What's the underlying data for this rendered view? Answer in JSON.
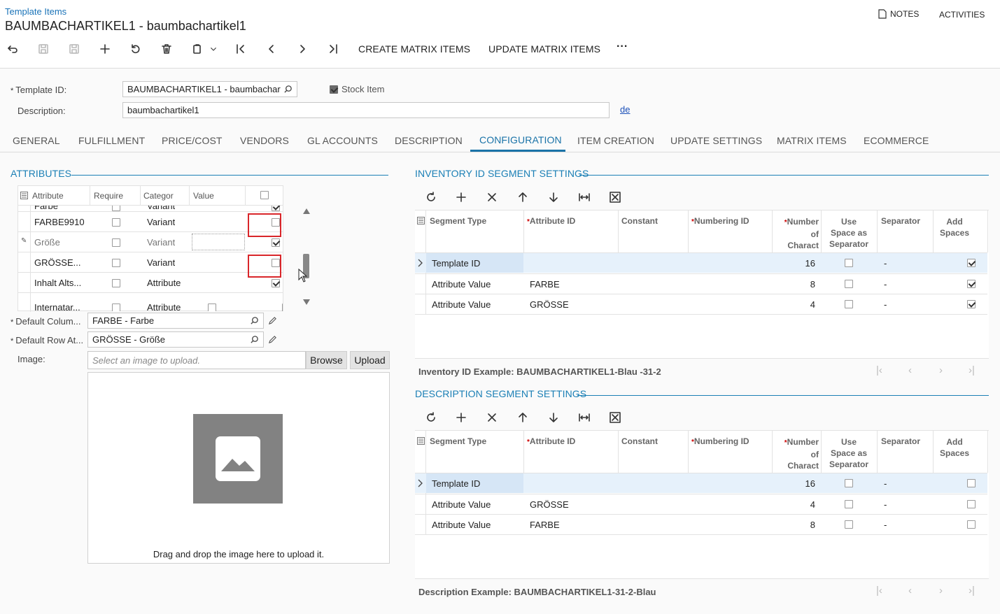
{
  "header": {
    "breadcrumb": "Template Items",
    "title": "BAUMBACHARTIKEL1 - baumbachartikel1",
    "notes": "NOTES",
    "activities": "ACTIVITIES"
  },
  "toolbar": {
    "create_matrix": "CREATE MATRIX ITEMS",
    "update_matrix": "UPDATE MATRIX ITEMS",
    "more": "···"
  },
  "form": {
    "template_id_label": "Template ID:",
    "template_id_value": "BAUMBACHARTIKEL1 - baumbachar",
    "stock_item_label": "Stock Item",
    "description_label": "Description:",
    "description_value": "baumbachartikel1",
    "lang": "de"
  },
  "tabs": [
    "GENERAL",
    "FULFILLMENT",
    "PRICE/COST",
    "VENDORS",
    "GL ACCOUNTS",
    "DESCRIPTION",
    "CONFIGURATION",
    "ITEM CREATION",
    "UPDATE SETTINGS",
    "MATRIX ITEMS",
    "ECOMMERCE"
  ],
  "attributes": {
    "title": "ATTRIBUTES",
    "columns": [
      "Attribute",
      "Require",
      "Categor",
      "Value"
    ],
    "rows": [
      {
        "attribute": "Farbe",
        "category": "Variant",
        "required": false,
        "checked": true
      },
      {
        "attribute": "FARBE9910",
        "category": "Variant",
        "required": false,
        "checked": false
      },
      {
        "attribute": "Größe",
        "category": "Variant",
        "required": false,
        "checked": true
      },
      {
        "attribute": "GRÖSSE...",
        "category": "Variant",
        "required": false,
        "checked": false
      },
      {
        "attribute": "Inhalt Alts...",
        "category": "Attribute",
        "required": false,
        "checked": true
      },
      {
        "attribute": "Internatar...",
        "category": "Attribute",
        "required": false,
        "checked": true
      }
    ],
    "default_column_label": "Default Colum...",
    "default_column_value": "FARBE - Farbe",
    "default_row_label": "Default Row At...",
    "default_row_value": "GRÖSSE - Größe",
    "image_label": "Image:",
    "image_placeholder": "Select an image to upload.",
    "browse": "Browse",
    "upload": "Upload",
    "drop_text": "Drag and drop the image here to upload it."
  },
  "inventory_segments": {
    "title": "INVENTORY ID SEGMENT SETTINGS",
    "columns": {
      "segment_type": "Segment Type",
      "attribute_id": "Attribute ID",
      "constant": "Constant",
      "numbering_id": "Numbering ID",
      "number_a": "Number",
      "number_b": "of",
      "number_c": "Charact",
      "use_a": "Use",
      "use_b": "Space as",
      "use_c": "Separator",
      "separator": "Separator",
      "add_a": "Add",
      "add_b": "Spaces"
    },
    "rows": [
      {
        "segment_type": "Template ID",
        "attribute_id": "",
        "number": "16",
        "use_space": false,
        "separator": "-",
        "add_spaces": true
      },
      {
        "segment_type": "Attribute Value",
        "attribute_id": "FARBE",
        "number": "8",
        "use_space": false,
        "separator": "-",
        "add_spaces": true
      },
      {
        "segment_type": "Attribute Value",
        "attribute_id": "GRÖSSE",
        "number": "4",
        "use_space": false,
        "separator": "-",
        "add_spaces": true
      }
    ],
    "example": "Inventory ID Example: BAUMBACHARTIKEL1-Blau -31-2"
  },
  "description_segments": {
    "title": "DESCRIPTION SEGMENT SETTINGS",
    "rows": [
      {
        "segment_type": "Template ID",
        "attribute_id": "",
        "number": "16",
        "use_space": false,
        "separator": "-",
        "add_spaces": false
      },
      {
        "segment_type": "Attribute Value",
        "attribute_id": "GRÖSSE",
        "number": "4",
        "use_space": false,
        "separator": "-",
        "add_spaces": false
      },
      {
        "segment_type": "Attribute Value",
        "attribute_id": "FARBE",
        "number": "8",
        "use_space": false,
        "separator": "-",
        "add_spaces": false
      }
    ],
    "example": "Description Example: BAUMBACHARTIKEL1-31-2-Blau"
  },
  "colors": {
    "accent": "#1a7fb5",
    "selected_row": "#e6f1fb",
    "highlight_box": "#d9262a"
  }
}
